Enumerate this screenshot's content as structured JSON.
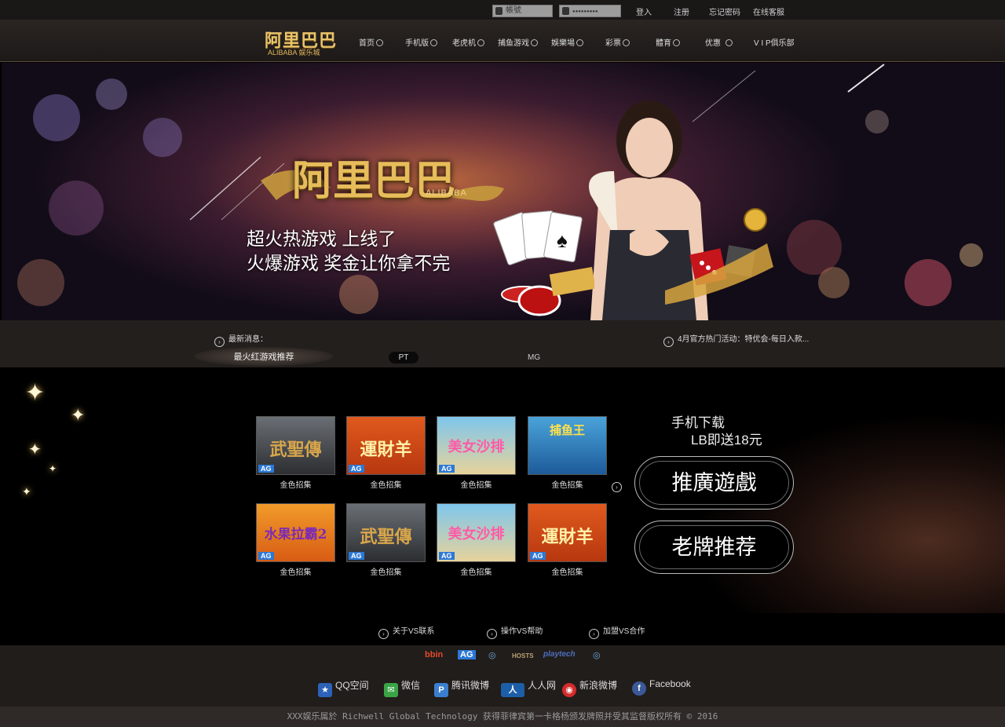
{
  "topbar": {
    "account_placeholder": "帳號",
    "password_placeholder": "●●●●●●●●●",
    "login": "登入",
    "register": "注册",
    "forgot": "忘记密码",
    "support": "在线客服"
  },
  "nav": {
    "logo_cn": "阿里巴巴",
    "logo_en": "ALIBABA 娱乐城",
    "items": [
      "首页",
      "手机版",
      "老虎机",
      "捕鱼游戏",
      "娛樂場",
      "彩票",
      "體育",
      "优惠",
      "V I P俱乐部"
    ]
  },
  "banner": {
    "logo_cn": "阿里巴巴",
    "logo_en": "ALIBABA",
    "slogan1": "超火热游戏 上线了",
    "slogan2": "火爆游戏 奖金让你拿不完"
  },
  "news": {
    "label": "最新消息：",
    "headline": "4月官方热门活动：特优会-每日入款..."
  },
  "tabs": [
    "最火红游戏推荐",
    "PT",
    "MG"
  ],
  "games": [
    {
      "title": "武聖傳",
      "label": "金色招集",
      "badge": "AG"
    },
    {
      "title": "運財羊",
      "label": "金色招集",
      "badge": "AG"
    },
    {
      "title": "美女沙排",
      "label": "金色招集",
      "badge": "AG"
    },
    {
      "title": "捕鱼王",
      "label": "金色招集",
      "badge": ""
    },
    {
      "title": "水果拉霸2",
      "label": "金色招集",
      "badge": "AG"
    },
    {
      "title": "武聖傳",
      "label": "金色招集",
      "badge": "AG"
    },
    {
      "title": "美女沙排",
      "label": "金色招集",
      "badge": "AG"
    },
    {
      "title": "運財羊",
      "label": "金色招集",
      "badge": "AG"
    }
  ],
  "side": {
    "download_line1": "手机下载",
    "download_line2": "LB即送18元",
    "promo_button": "推廣遊戲",
    "classic_button": "老牌推荐"
  },
  "links": [
    "关于VS联系",
    "操作VS帮助",
    "加盟VS合作"
  ],
  "partners": [
    "bbin",
    "AG",
    "◎",
    "HOSTS",
    "playtech",
    "◎"
  ],
  "social": [
    {
      "label": "QQ空间",
      "icon": "star-icon",
      "color": "#2c63b8"
    },
    {
      "label": "微信",
      "icon": "wechat-icon",
      "color": "#3aa447"
    },
    {
      "label": "腾讯微博",
      "icon": "tencent-weibo-icon",
      "color": "#3a7fcf"
    },
    {
      "label": "人人网",
      "icon": "renren-icon",
      "color": "#1d5ea8"
    },
    {
      "label": "新浪微博",
      "icon": "sina-weibo-icon",
      "color": "#d52b2b"
    },
    {
      "label": "Facebook",
      "icon": "facebook-icon",
      "color": "#3b5998"
    }
  ],
  "footer": "XXX娱乐属於 Richwell Global Technology 获得菲律宾第一卡格杨颁发牌照并受其监督版权所有 © 2016"
}
